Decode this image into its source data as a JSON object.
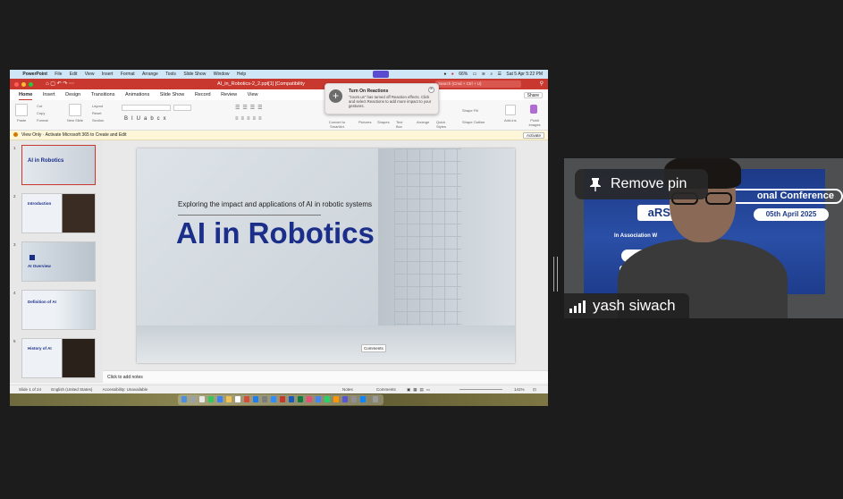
{
  "mac_menubar": {
    "app_name": "PowerPoint",
    "menus": [
      "File",
      "Edit",
      "View",
      "Insert",
      "Format",
      "Arrange",
      "Tools",
      "Slide Show",
      "Window",
      "Help"
    ],
    "battery": "66%",
    "datetime": "Sat 5 Apr  5:22 PM"
  },
  "window": {
    "title": "AI_in_Robotics-2_2.ppt[1] [Compatibility",
    "search_placeholder": "Search (Cmd + Ctrl + U)"
  },
  "ribbon": {
    "tabs": [
      "Home",
      "Insert",
      "Design",
      "Transitions",
      "Animations",
      "Slide Show",
      "Record",
      "Review",
      "View"
    ],
    "active_tab": "Home",
    "share_label": "Share",
    "clipboard": {
      "paste": "Paste",
      "cut": "Cut",
      "copy": "Copy",
      "format": "Format"
    },
    "slides": {
      "new_slide": "New Slide",
      "layout": "Layout",
      "reset": "Reset",
      "section": "Section"
    },
    "right_labels": {
      "convert": "Convert to SmartArt",
      "pictures": "Pictures",
      "shapes": "Shapes",
      "text_box": "Text Box",
      "arrange": "Arrange",
      "quick_styles": "Quick Styles",
      "shape_fill": "Shape Fill",
      "shape_outline": "Shape Outline",
      "add_ins": "Add-ins",
      "pickit": "Pickit Images"
    }
  },
  "toast": {
    "title": "Turn On Reactions",
    "body": "\"zoom.us\" has turned off Reaction effects. Click  and select Reactions to add more impact to your gestures.",
    "close_glyph": "×",
    "plus_glyph": "+"
  },
  "infobar": {
    "message": "View Only · Activate Microsoft 365 to Create and Edit",
    "activate_label": "Activate"
  },
  "thumbnails": [
    {
      "num": "1",
      "title": "AI in Robotics"
    },
    {
      "num": "2",
      "title": "Introduction"
    },
    {
      "num": "3",
      "title": "AI Overview"
    },
    {
      "num": "4",
      "title": "Definition of AI"
    },
    {
      "num": "5",
      "title": "History of AI"
    }
  ],
  "slide": {
    "subtitle": "Exploring the impact and applications of AI in robotic systems",
    "title": "AI in Robotics",
    "comments_label": "Comments"
  },
  "notes_placeholder": "Click to add notes",
  "statusbar": {
    "slide_count": "Slide 1 of 24",
    "language": "English (United States)",
    "accessibility": "Accessibility: Unavailable",
    "notes": "Notes",
    "comments": "Comments",
    "zoom": "141%"
  },
  "video": {
    "participant_name": "yash siwach",
    "pin_label": "Remove pin",
    "banner_conference": "onal Conference",
    "banner_date": "05th April 2025",
    "banner_logo": "aRSSS",
    "banner_line": "In Association W"
  },
  "colors": {
    "ppt_red": "#c8382e",
    "slide_title_blue": "#1b2f8a",
    "banner_blue": "#1d3a88"
  }
}
